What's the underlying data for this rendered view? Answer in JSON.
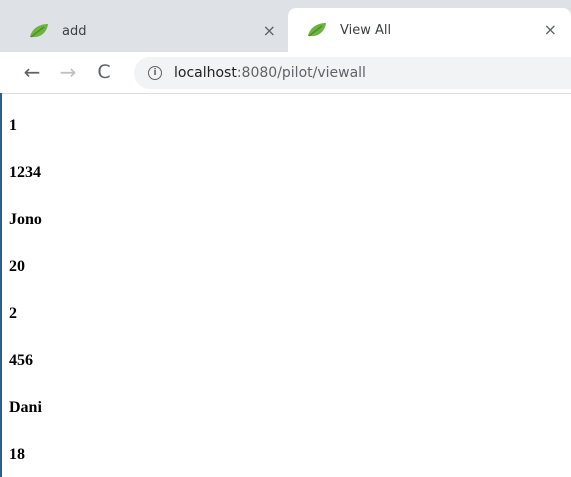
{
  "tabs": [
    {
      "title": "add",
      "close": "×",
      "active": false
    },
    {
      "title": "View All",
      "close": "×",
      "active": true
    }
  ],
  "toolbar": {
    "back": "←",
    "forward": "→",
    "reload": "C",
    "url_host": "localhost",
    "url_path": ":8080/pilot/viewall",
    "info": "i"
  },
  "records": [
    "1",
    "1234",
    "Jono",
    "20",
    "2",
    "456",
    "Dani",
    "18"
  ],
  "colors": {
    "tabstrip": "#dee1e6",
    "favicon_leaf": "#6db33f",
    "content_border": "#2f5e8c"
  }
}
